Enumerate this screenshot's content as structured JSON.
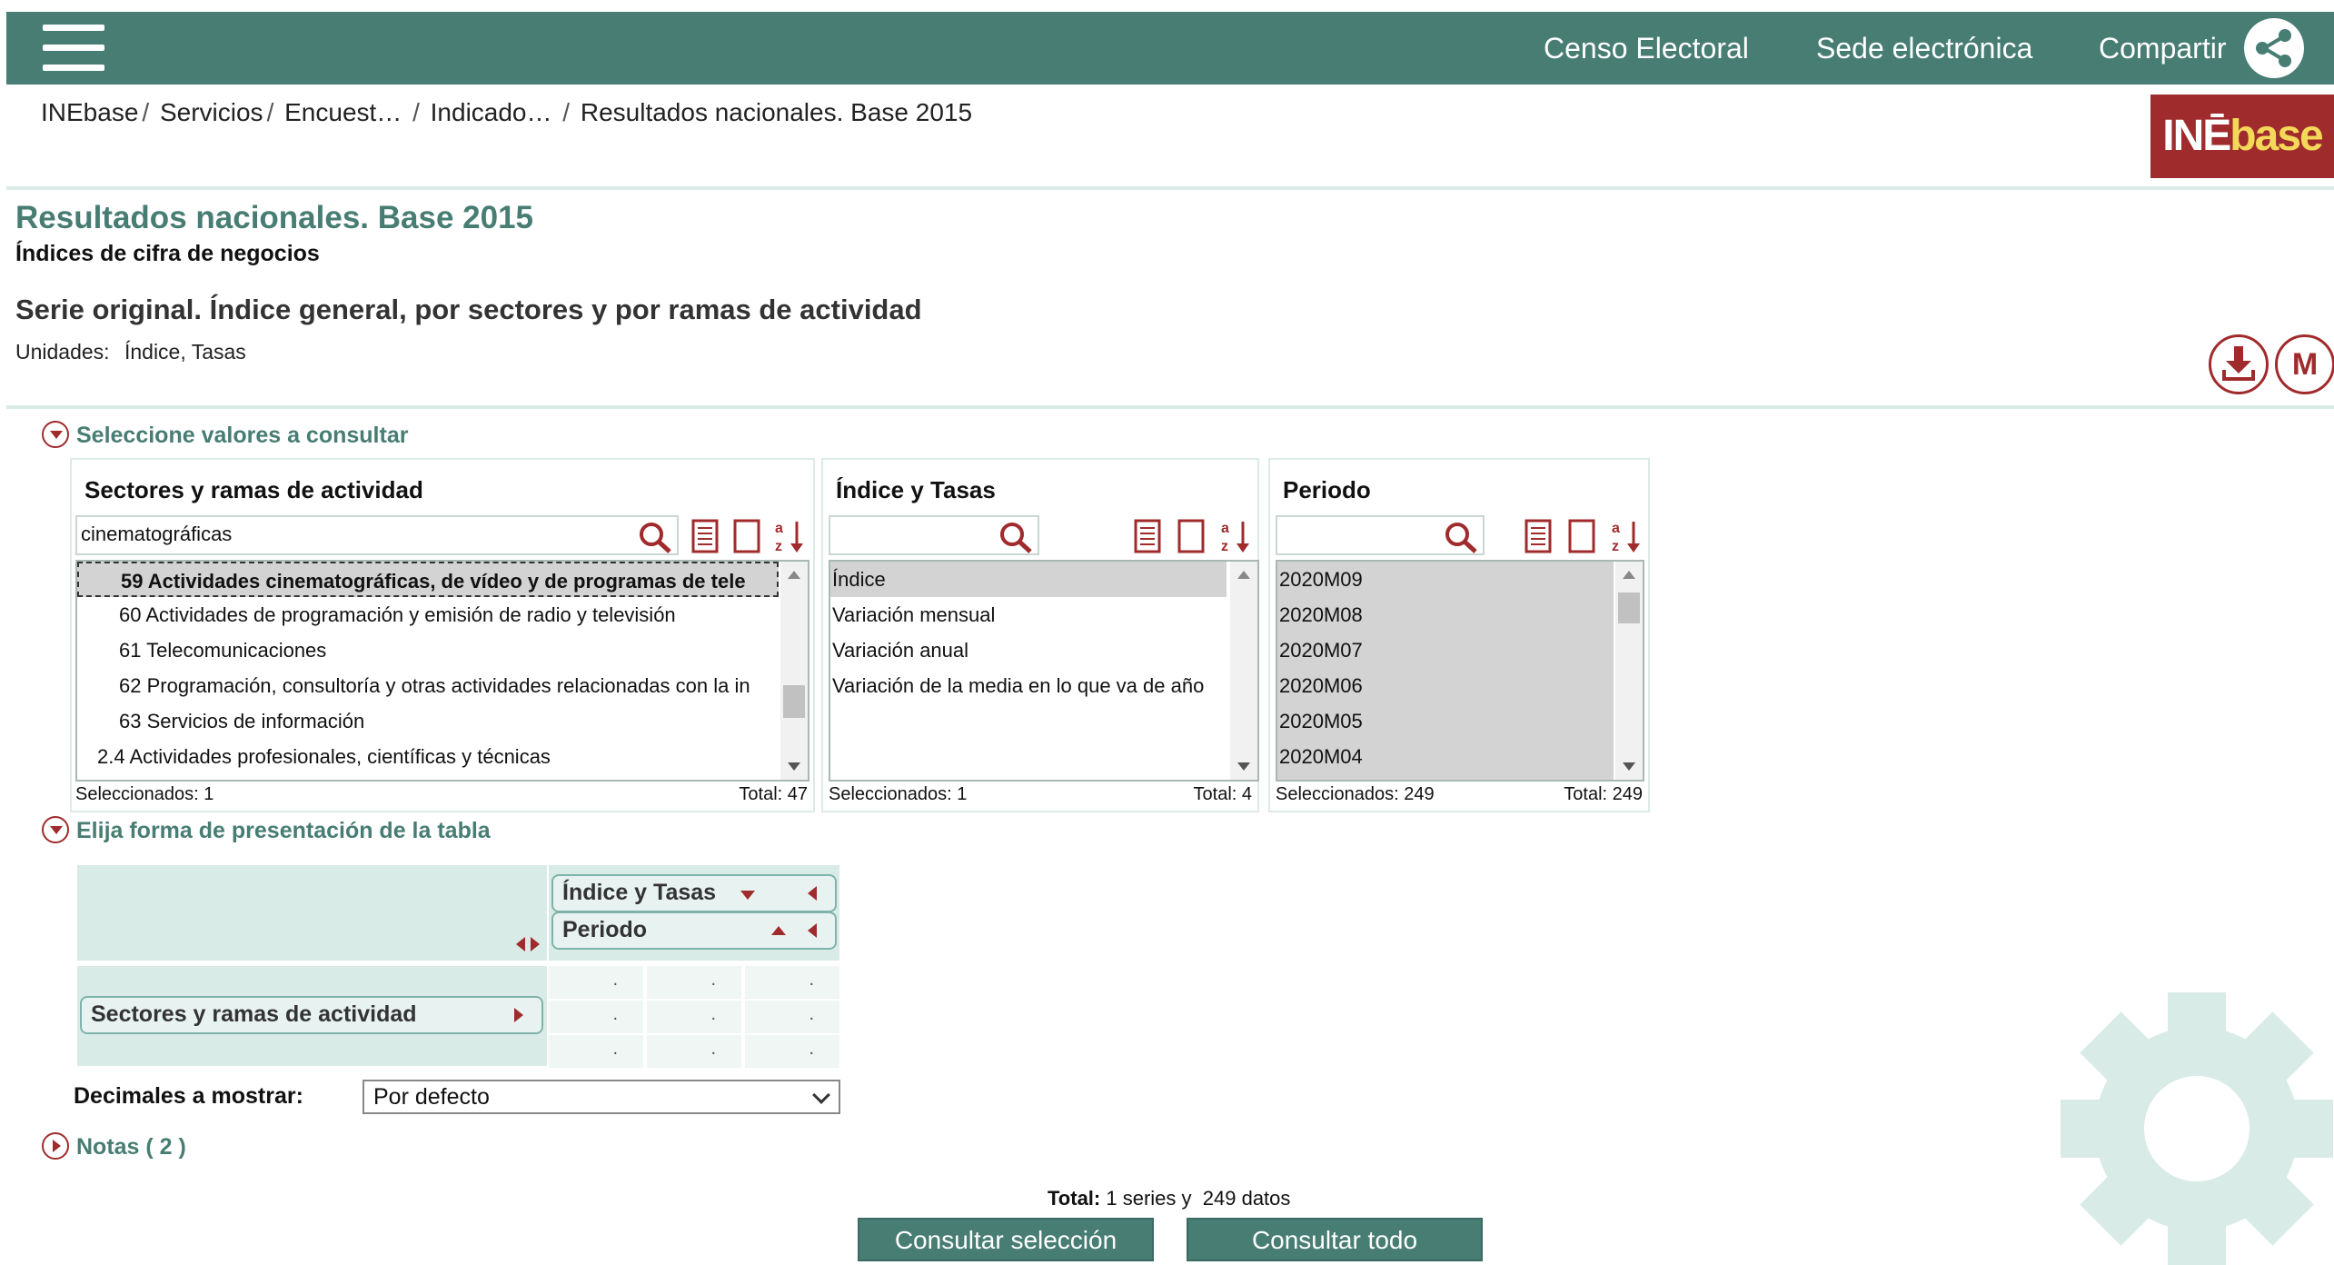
{
  "header": {
    "nav": [
      "Censo Electoral",
      "Sede electrónica",
      "Compartir"
    ]
  },
  "breadcrumb": [
    "INEbase",
    "Servicios",
    "Encuest…",
    "Indicado…",
    "Resultados nacionales. Base 2015"
  ],
  "logo": {
    "text_a": "INĒ",
    "text_b": "base"
  },
  "page": {
    "title": "Resultados nacionales. Base 2015",
    "subtitle": "Índices de cifra de negocios",
    "serie": "Serie original. Índice general, por sectores y por ramas de actividad",
    "units_label": "Unidades:",
    "units_value": "Índice, Tasas",
    "download_icon": "download-icon",
    "menu_icon_label": "M"
  },
  "sections": {
    "select_values": "Seleccione valores a consultar",
    "presentation": "Elija forma de presentación de la tabla",
    "notes": "Notas ( 2 )"
  },
  "panels": [
    {
      "title": "Sectores y ramas de actividad",
      "search_value": "cinematográficas",
      "items": [
        "59 Actividades cinematográficas, de vídeo y de programas de tele",
        "60 Actividades de programación y emisión de radio y televisión",
        "61 Telecomunicaciones",
        "62 Programación, consultoría y otras actividades relacionadas con la in",
        "63 Servicios de información",
        "2.4 Actividades profesionales, científicas y técnicas"
      ],
      "selected_label": "Seleccionados: 1",
      "total_label": "Total: 47"
    },
    {
      "title": "Índice y Tasas",
      "search_value": "",
      "items": [
        "Índice",
        "Variación mensual",
        "Variación anual",
        "Variación de la media en lo que va de año"
      ],
      "selected_label": "Seleccionados: 1",
      "total_label": "Total: 4"
    },
    {
      "title": "Periodo",
      "search_value": "",
      "items": [
        "2020M09",
        "2020M08",
        "2020M07",
        "2020M06",
        "2020M05",
        "2020M04"
      ],
      "selected_label": "Seleccionados: 249",
      "total_label": "Total: 249"
    }
  ],
  "layout_table": {
    "col_dims": [
      "Índice y Tasas",
      "Periodo"
    ],
    "row_dims": [
      "Sectores y ramas de actividad"
    ],
    "cell_placeholder": "."
  },
  "decimals": {
    "label": "Decimales a mostrar:",
    "value": "Por defecto"
  },
  "totals": {
    "label": "Total:",
    "series": "1 series y",
    "datos": "249 datos"
  },
  "buttons": {
    "consult_selection": "Consultar selección",
    "consult_all": "Consultar todo"
  },
  "colors": {
    "brand": "#477d73",
    "accent": "#a02b2d",
    "light": "#d9ebe7"
  }
}
